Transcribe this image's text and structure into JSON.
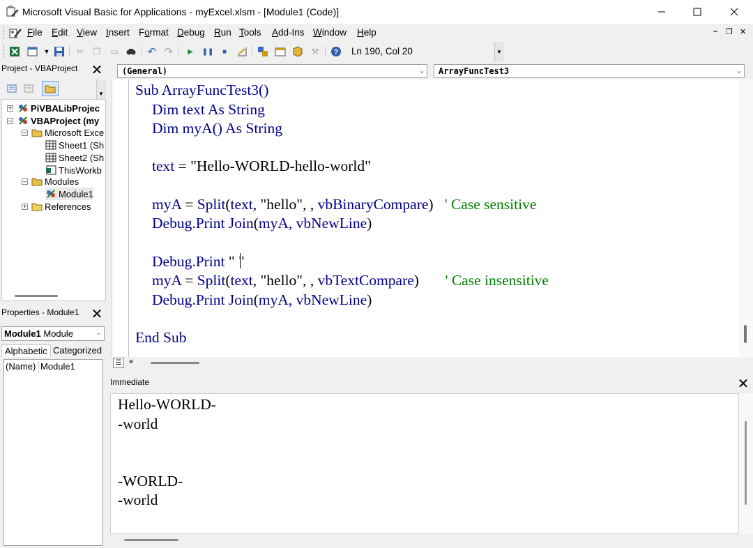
{
  "window": {
    "title": "Microsoft Visual Basic for Applications - myExcel.xlsm - [Module1 (Code)]",
    "minimize_icon": "minimize-icon",
    "maximize_icon": "maximize-icon",
    "close_icon": "close-icon"
  },
  "menu": {
    "items": [
      {
        "pre": "",
        "u": "F",
        "post": "ile"
      },
      {
        "pre": "",
        "u": "E",
        "post": "dit"
      },
      {
        "pre": "",
        "u": "V",
        "post": "iew"
      },
      {
        "pre": "",
        "u": "I",
        "post": "nsert"
      },
      {
        "pre": "F",
        "u": "o",
        "post": "rmat"
      },
      {
        "pre": "",
        "u": "D",
        "post": "ebug"
      },
      {
        "pre": "",
        "u": "R",
        "post": "un"
      },
      {
        "pre": "",
        "u": "T",
        "post": "ools"
      },
      {
        "pre": "",
        "u": "A",
        "post": "dd-Ins"
      },
      {
        "pre": "",
        "u": "W",
        "post": "indow"
      },
      {
        "pre": "",
        "u": "H",
        "post": "elp"
      }
    ]
  },
  "toolbar": {
    "position": "Ln 190, Col 20"
  },
  "project_panel": {
    "title": "Project - VBAProject",
    "tree": [
      {
        "label": "PiVBALibProjec",
        "bold": true
      },
      {
        "label": "VBAProject (my",
        "bold": true
      },
      {
        "label": "Microsoft Exce"
      },
      {
        "label": "Sheet1 (Sh"
      },
      {
        "label": "Sheet2 (Sh"
      },
      {
        "label": "ThisWorkb"
      },
      {
        "label": "Modules"
      },
      {
        "label": "Module1"
      },
      {
        "label": "References"
      }
    ]
  },
  "properties_panel": {
    "title": "Properties - Module1",
    "object_name": "Module1",
    "object_type": "Module",
    "tabs": [
      "Alphabetic",
      "Categorized"
    ],
    "rows": [
      {
        "name": "(Name)",
        "value": "Module1"
      }
    ]
  },
  "code_window": {
    "object_combo": "(General)",
    "procedure_combo": "ArrayFuncTest3"
  },
  "code": {
    "l1": {
      "a": "Sub ArrayFuncTest3()"
    },
    "l2": {
      "a": "Dim text As String"
    },
    "l3": {
      "a": "Dim myA() As String"
    },
    "l4": {
      "a": "text",
      "b": " = \"Hello-WORLD-hello-world\""
    },
    "l5": {
      "a": "myA",
      "b": " = ",
      "c": "Split",
      "d": "(",
      "e": "text",
      "f": ", \"hello\", , ",
      "g": "vbBinaryCompare",
      "h": ")   ",
      "i": "' Case sensitive"
    },
    "l6": {
      "a": "Debug.Print Join",
      "b": "(",
      "c": "myA, vbNewLine",
      "d": ")"
    },
    "l7": {
      "a": "Debug.Print",
      "b": " \" \""
    },
    "l8": {
      "a": "myA",
      "b": " = ",
      "c": "Split",
      "d": "(",
      "e": "text",
      "f": ", \"hello\", , ",
      "g": "vbTextCompare",
      "h": ")       ",
      "i": "' Case insensitive"
    },
    "l9": {
      "a": "Debug.Print Join",
      "b": "(",
      "c": "myA, vbNewLine",
      "d": ")"
    },
    "l10": {
      "a": "End Sub"
    }
  },
  "immediate": {
    "title": "Immediate",
    "lines": [
      "Hello-WORLD-",
      "-world",
      "",
      "",
      "-WORLD-",
      "-world"
    ]
  }
}
